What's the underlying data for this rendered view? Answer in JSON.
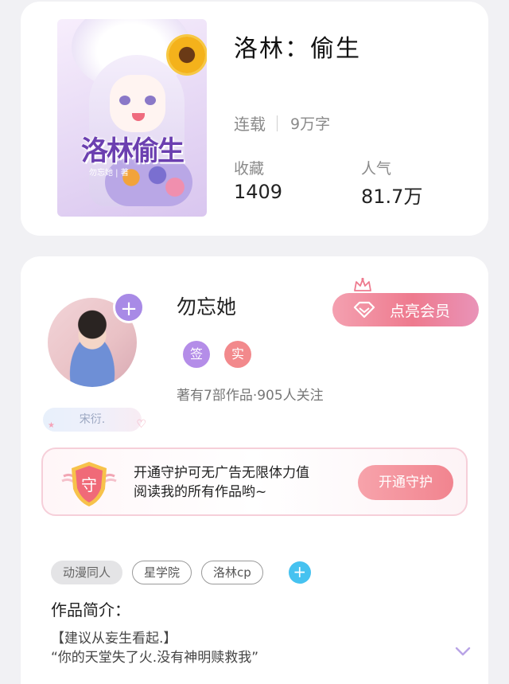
{
  "colors": {
    "vip_gradient": [
      "#f4a0b0",
      "#ee7a8e",
      "#e993b8"
    ],
    "sign_tag": "#b48de8",
    "real_tag": "#f2898c",
    "add_tag": "#46c2f0",
    "avatar_plus": "#a88ae6",
    "guard_button": "#f1848f"
  },
  "book": {
    "cover_title": "洛林偷生",
    "cover_author": "勿忘她 | 著",
    "title": "洛林：偷生",
    "status": "连载",
    "word_count": "9万字",
    "favorites_label": "收藏",
    "favorites_value": "1409",
    "popularity_label": "人气",
    "popularity_value": "81.7万"
  },
  "author": {
    "name": "勿忘她",
    "follow_icon": "plus-icon",
    "vip_button": "点亮会员",
    "badge_sign": "签",
    "badge_real": "实",
    "works_summary": "著有7部作品·905人关注",
    "fan_badge": "宋衍.",
    "guard": {
      "line1": "开通守护可无广告无限体力值",
      "line2": "阅读我的所有作品哟~",
      "shield_char": "守",
      "button": "开通守护"
    },
    "tags": [
      {
        "label": "动漫同人",
        "style": "filled"
      },
      {
        "label": "星学院",
        "style": "outline"
      },
      {
        "label": "洛林cp",
        "style": "outline"
      }
    ],
    "add_tag_icon": "plus-icon",
    "intro_title": "作品简介：",
    "intro_line1": "【建议从妄生看起.】",
    "intro_line2": "“你的天堂失了火.没有神明赎救我”",
    "expand_icon": "chevron-down-icon"
  }
}
